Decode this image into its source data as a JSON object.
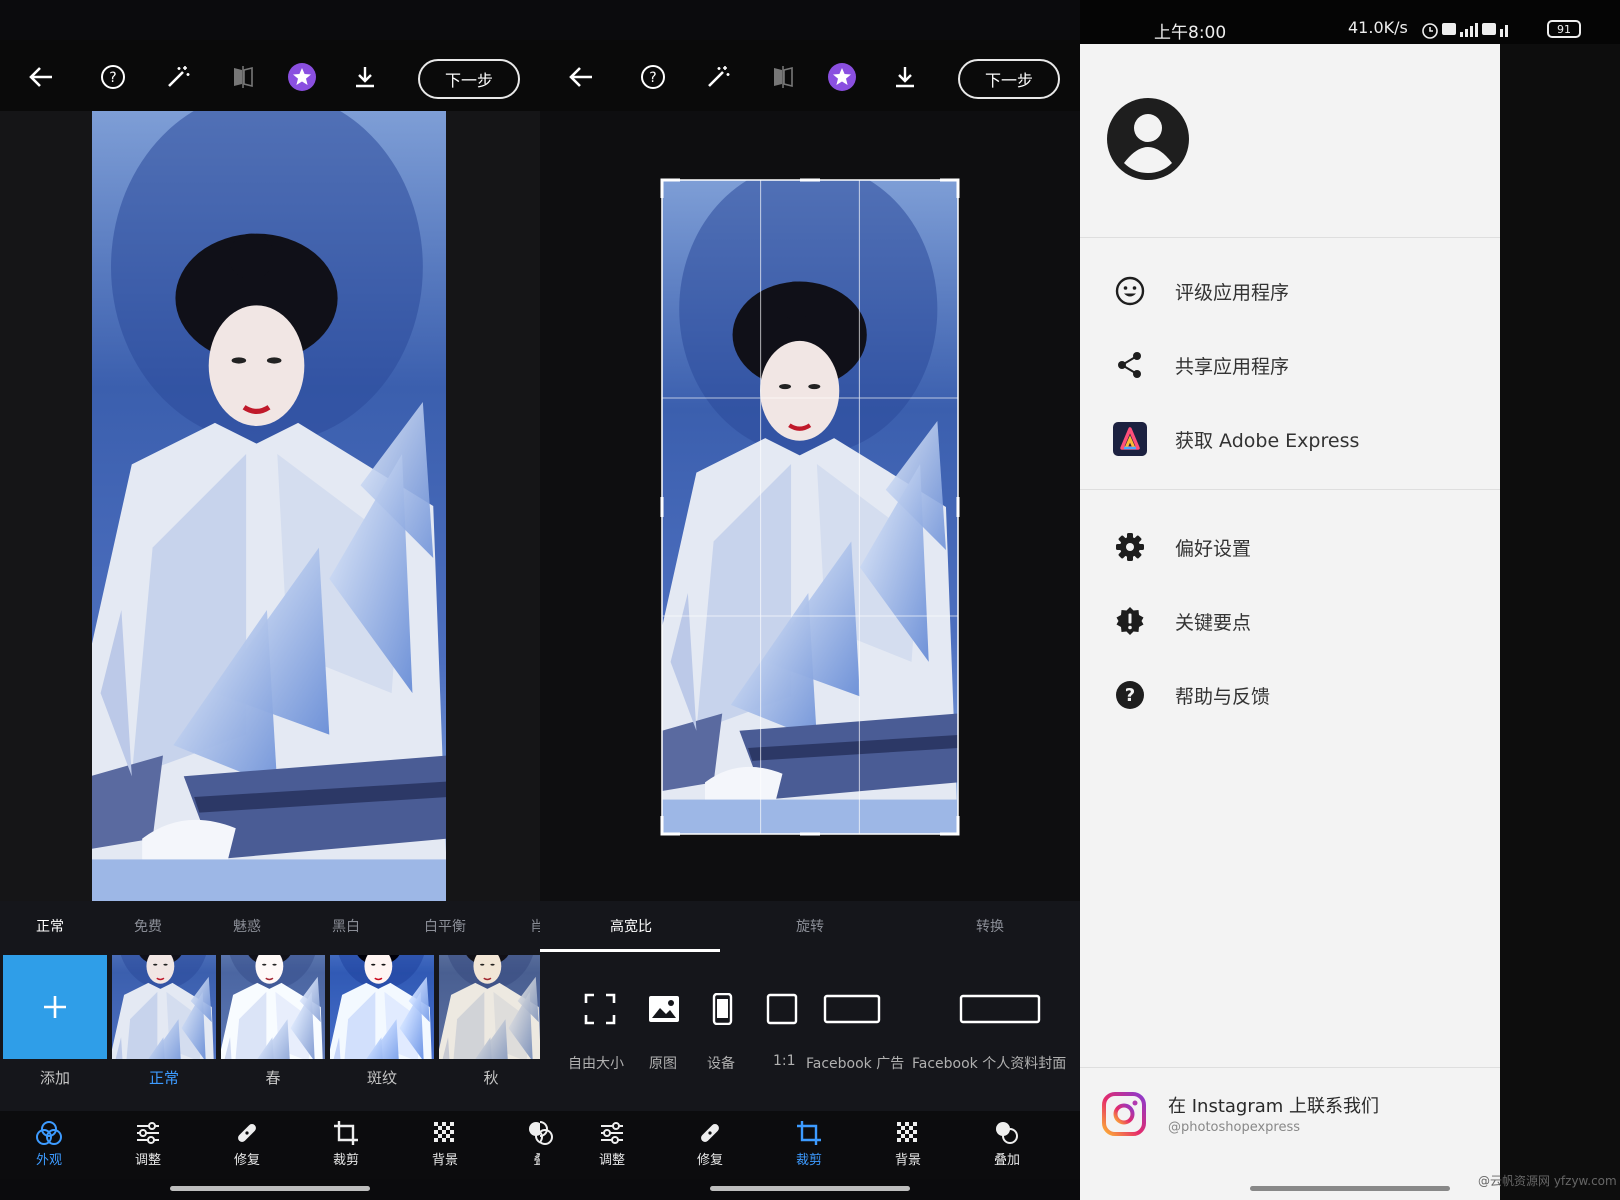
{
  "colors": {
    "accent": "#3d9bff",
    "star": "#8a4fe0",
    "add_tile": "#2f9ee8",
    "drawer_bg": "#f3f3f3"
  },
  "toolbar": {
    "icons": [
      "back-arrow-icon",
      "help-icon",
      "magic-wand-icon",
      "compare-icon",
      "premium-star-icon",
      "download-icon"
    ],
    "next_label": "下一步"
  },
  "looks_panel": {
    "tabs": [
      "正常",
      "免费",
      "魅惑",
      "黑白",
      "白平衡",
      "肖"
    ],
    "active_tab": 0,
    "thumbs": [
      {
        "label": "添加",
        "type": "add"
      },
      {
        "label": "正常",
        "selected": true
      },
      {
        "label": "春"
      },
      {
        "label": "斑纹"
      },
      {
        "label": "秋"
      }
    ]
  },
  "crop_panel": {
    "tabs": [
      "高宽比",
      "旋转",
      "转换"
    ],
    "active_tab": 0,
    "ratios": [
      "自由大小",
      "原图",
      "设备",
      "1:1",
      "Facebook 广告",
      "Facebook 个人资料封面"
    ]
  },
  "bottom_nav_1": [
    {
      "label": "外观",
      "icon": "looks-icon",
      "active": true
    },
    {
      "label": "调整",
      "icon": "sliders-icon"
    },
    {
      "label": "修复",
      "icon": "bandage-icon"
    },
    {
      "label": "裁剪",
      "icon": "crop-icon"
    },
    {
      "label": "背景",
      "icon": "background-icon"
    },
    {
      "label": "叠",
      "icon": "blend-icon"
    }
  ],
  "bottom_nav_2": [
    {
      "label": "叠",
      "icon": "looks-icon"
    },
    {
      "label": "调整",
      "icon": "sliders-icon"
    },
    {
      "label": "修复",
      "icon": "bandage-icon"
    },
    {
      "label": "裁剪",
      "icon": "crop-icon",
      "active": true
    },
    {
      "label": "背景",
      "icon": "background-icon"
    },
    {
      "label": "叠加",
      "icon": "blend-icon"
    }
  ],
  "status_bar": {
    "time": "上午8:00",
    "speed": "41.0K/s",
    "battery": "91"
  },
  "drawer": {
    "menu_group_1": [
      {
        "label": "评级应用程序",
        "icon": "smiley-icon"
      },
      {
        "label": "共享应用程序",
        "icon": "share-icon"
      },
      {
        "label": "获取 Adobe Express",
        "icon": "adobe-express-icon"
      }
    ],
    "menu_group_2": [
      {
        "label": "偏好设置",
        "icon": "gear-icon"
      },
      {
        "label": "关键要点",
        "icon": "alert-badge-icon"
      },
      {
        "label": "帮助与反馈",
        "icon": "help-circle-icon"
      }
    ],
    "instagram": {
      "title": "在 Instagram 上联系我们",
      "handle": "@photoshopexpress"
    }
  },
  "watermark": "@云帆资源网 yfzyw.com"
}
